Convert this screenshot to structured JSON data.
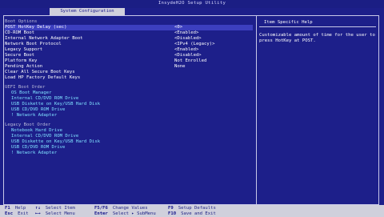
{
  "app": {
    "title": "InsydeH2O Setup Utility"
  },
  "tabs": [
    {
      "label": "System Configuration"
    }
  ],
  "settings": [
    {
      "label": "Boot Options",
      "value": "",
      "style": "dim"
    },
    {
      "label": "POST HotKey Delay (sec)",
      "value": "<0>",
      "style": "selected"
    },
    {
      "label": "CD-ROM Boot",
      "value": "<Enabled>",
      "style": ""
    },
    {
      "label": "Internal Network Adapter Boot",
      "value": "<Disabled>",
      "style": ""
    },
    {
      "label": "Network Boot Protocol",
      "value": "<IPv4 (Legacy)>",
      "style": ""
    },
    {
      "label": "Legacy Support",
      "value": "<Enabled>",
      "style": ""
    },
    {
      "label": "Secure Boot",
      "value": "<Disabled>",
      "style": ""
    },
    {
      "label": "Platform Key",
      "value": "Not Enrolled",
      "style": ""
    },
    {
      "label": "Pending Action",
      "value": "None",
      "style": ""
    },
    {
      "label": "Clear All Secure Boot Keys",
      "value": "",
      "style": ""
    },
    {
      "label": "Load HP Factory Default Keys",
      "value": "",
      "style": ""
    }
  ],
  "uefi_boot_order": {
    "heading": "UEFI Boot Order",
    "items": [
      "OS Boot Manager",
      "Internal CD/DVD ROM Drive",
      "USB Diskette on Key/USB Hard Disk",
      "USB CD/DVD ROM Drive",
      "! Network Adapter"
    ]
  },
  "legacy_boot_order": {
    "heading": "Legacy Boot Order",
    "items": [
      "Notebook Hard Drive",
      "Internal CD/DVD ROM Drive",
      "USB Diskette on Key/USB Hard Disk",
      "USB CD/DVD ROM Drive",
      "! Network Adapter"
    ]
  },
  "help": {
    "title": "Item Specific Help",
    "text": "Customizable amount of time for the user to press HotKey at POST."
  },
  "footer": {
    "items": [
      {
        "key": "F1",
        "desc": "Help"
      },
      {
        "key": "Esc",
        "desc": "Exit"
      },
      {
        "key": "↑↓",
        "desc": "Select Item"
      },
      {
        "key": "←→",
        "desc": "Select Menu"
      },
      {
        "key": "F5/F6",
        "desc": "Change Values"
      },
      {
        "key": "Enter",
        "desc": "Select ▸ SubMenu"
      },
      {
        "key": "F9",
        "desc": "Setup Defaults"
      },
      {
        "key": "F10",
        "desc": "Save and Exit"
      }
    ]
  },
  "colors": {
    "background": "#1d1f8a",
    "highlight": "#3c3fbf",
    "footer": "#d0d0dc",
    "accent_text": "#7fe0ff"
  }
}
